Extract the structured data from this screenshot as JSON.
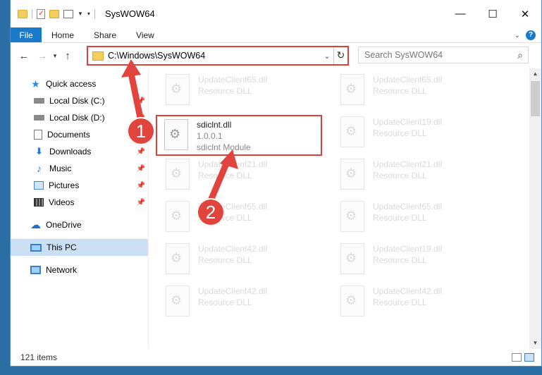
{
  "window": {
    "title": "SysWOW64",
    "controls": {
      "minimize": "—",
      "maximize": "☐",
      "close": "✕"
    }
  },
  "ribbon": {
    "tabs": [
      "File",
      "Home",
      "Share",
      "View"
    ]
  },
  "address": {
    "path": "C:\\Windows\\SysWOW64",
    "search_placeholder": "Search SysWOW64"
  },
  "nav": {
    "items": [
      {
        "label": "Quick access",
        "icon": "star-icon"
      },
      {
        "label": "Local Disk (C:)",
        "icon": "disk-icon",
        "pinned": true
      },
      {
        "label": "Local Disk (D:)",
        "icon": "disk-icon",
        "pinned": true
      },
      {
        "label": "Documents",
        "icon": "documents-icon",
        "pinned": true
      },
      {
        "label": "Downloads",
        "icon": "download-icon",
        "pinned": true
      },
      {
        "label": "Music",
        "icon": "music-icon",
        "pinned": true
      },
      {
        "label": "Pictures",
        "icon": "pictures-icon",
        "pinned": true
      },
      {
        "label": "Videos",
        "icon": "videos-icon",
        "pinned": true
      },
      {
        "label": "OneDrive",
        "icon": "cloud-icon"
      },
      {
        "label": "This PC",
        "icon": "computer-icon",
        "selected": true
      },
      {
        "label": "Network",
        "icon": "network-icon"
      }
    ]
  },
  "files": [
    {
      "name": "UpdateClient65.dll",
      "line2": "Resource DLL",
      "faded": true
    },
    {
      "name": "UpdateClient65.dll",
      "line2": "Resource DLL",
      "faded": true
    },
    {
      "name": "sdiclnt.dll",
      "line2": "1.0.0.1",
      "line3": "sdiclnt Module",
      "faded": false
    },
    {
      "name": "UpdateClient19.dll",
      "line2": "Resource DLL",
      "faded": true
    },
    {
      "name": "UpdateClient21.dll",
      "line2": "Resource DLL",
      "faded": true
    },
    {
      "name": "UpdateClient21.dll",
      "line2": "Resource DLL",
      "faded": true
    },
    {
      "name": "UpdateClient65.dll",
      "line2": "Resource DLL",
      "faded": true
    },
    {
      "name": "UpdateClient65.dll",
      "line2": "Resource DLL",
      "faded": true
    },
    {
      "name": "UpdateClient42.dll",
      "line2": "Resource DLL",
      "faded": true
    },
    {
      "name": "UpdateClient19.dll",
      "line2": "Resource DLL",
      "faded": true
    },
    {
      "name": "UpdateClient42.dll",
      "line2": "Resource DLL",
      "faded": true
    },
    {
      "name": "UpdateClient42.dll",
      "line2": "Resource DLL",
      "faded": true
    }
  ],
  "status": {
    "item_count": "121 items"
  },
  "callouts": [
    "1",
    "2"
  ],
  "colors": {
    "accent": "#1979ca",
    "highlight": "#d9413a",
    "selected": "#cce0f5"
  }
}
